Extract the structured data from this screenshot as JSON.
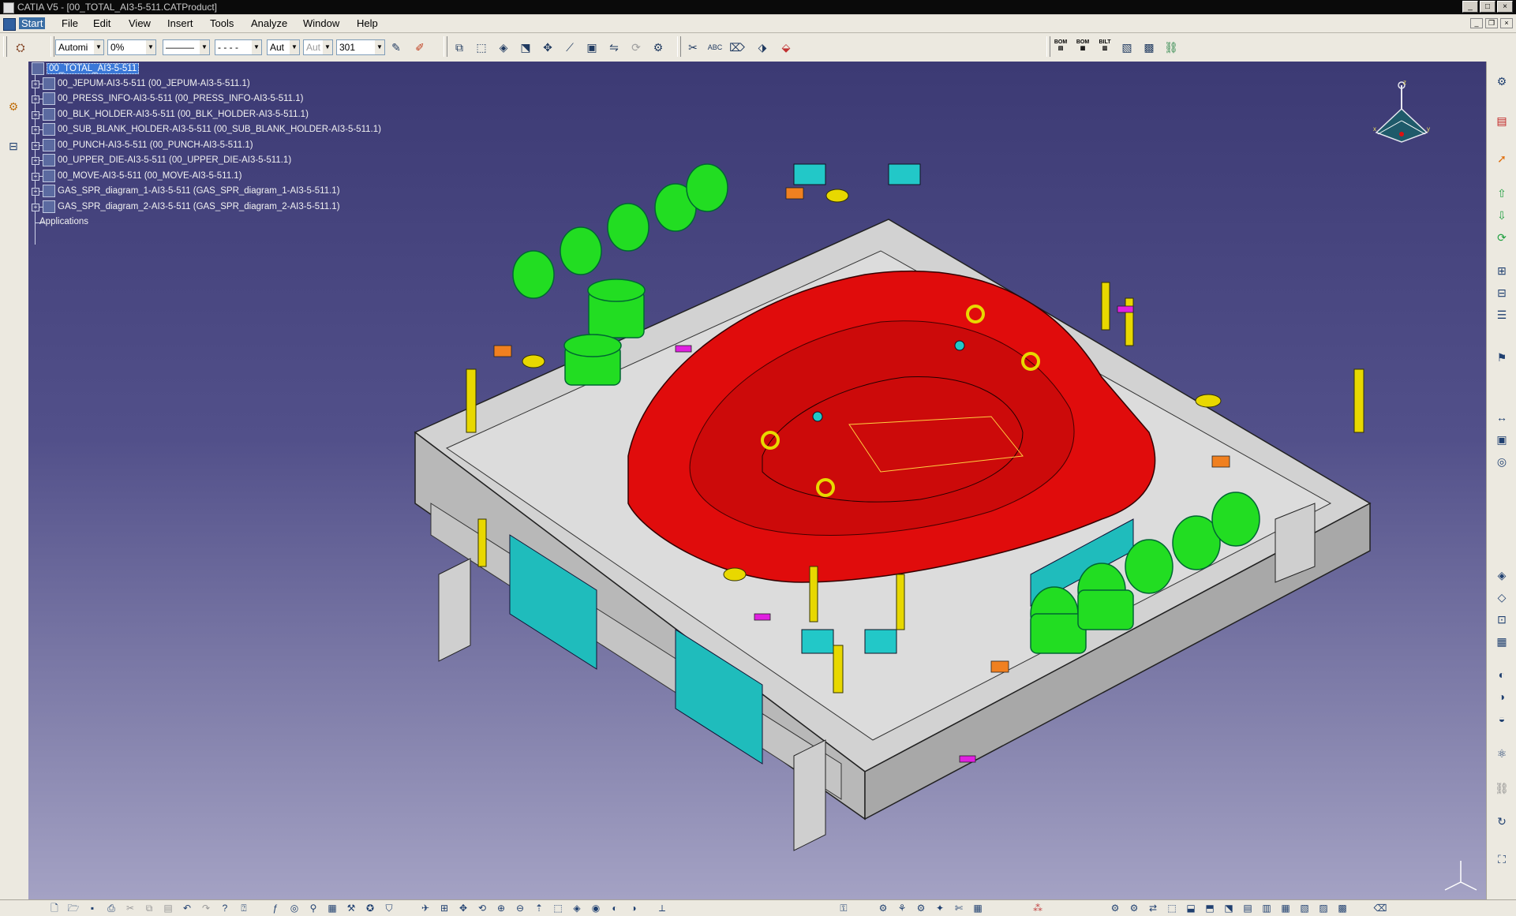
{
  "window": {
    "title": "CATIA V5 - [00_TOTAL_AI3-5-511.CATProduct]",
    "controls": [
      "_",
      "□",
      "×"
    ]
  },
  "menu": {
    "items": [
      "Start",
      "File",
      "Edit",
      "View",
      "Insert",
      "Tools",
      "Analyze",
      "Window",
      "Help"
    ]
  },
  "toolbar": {
    "graphic_props": {
      "color": "Automi",
      "transparency": "0%",
      "line_thickness": "———",
      "line_type": "- - - -",
      "layer": "Aut",
      "layer2": "Aut",
      "number": "301"
    },
    "bom_labels": [
      "BOM",
      "BOM",
      "BILT"
    ]
  },
  "tree": {
    "root": "00_TOTAL_AI3-5-511",
    "children": [
      "00_JEPUM-AI3-5-511 (00_JEPUM-AI3-5-511.1)",
      "00_PRESS_INFO-AI3-5-511 (00_PRESS_INFO-AI3-5-511.1)",
      "00_BLK_HOLDER-AI3-5-511 (00_BLK_HOLDER-AI3-5-511.1)",
      "00_SUB_BLANK_HOLDER-AI3-5-511 (00_SUB_BLANK_HOLDER-AI3-5-511.1)",
      "00_PUNCH-AI3-5-511 (00_PUNCH-AI3-5-511.1)",
      "00_UPPER_DIE-AI3-5-511 (00_UPPER_DIE-AI3-5-511.1)",
      "00_MOVE-AI3-5-511 (00_MOVE-AI3-5-511.1)",
      "GAS_SPR_diagram_1-AI3-5-511 (GAS_SPR_diagram_1-AI3-5-511.1)",
      "GAS_SPR_diagram_2-AI3-5-511 (GAS_SPR_diagram_2-AI3-5-511.1)"
    ],
    "applications": "Applications"
  },
  "compass": {
    "axes": [
      "x",
      "y",
      "z"
    ]
  },
  "colors": {
    "viewport_top": "#3c3a74",
    "viewport_bottom": "#a4a2c4",
    "punch_red": "#e01010",
    "die_grey": "#d8d8d8",
    "cylinder_green": "#22dd22",
    "plate_cyan": "#22c0c0",
    "part_yellow": "#e8d800",
    "selection": "#3a78d8"
  }
}
